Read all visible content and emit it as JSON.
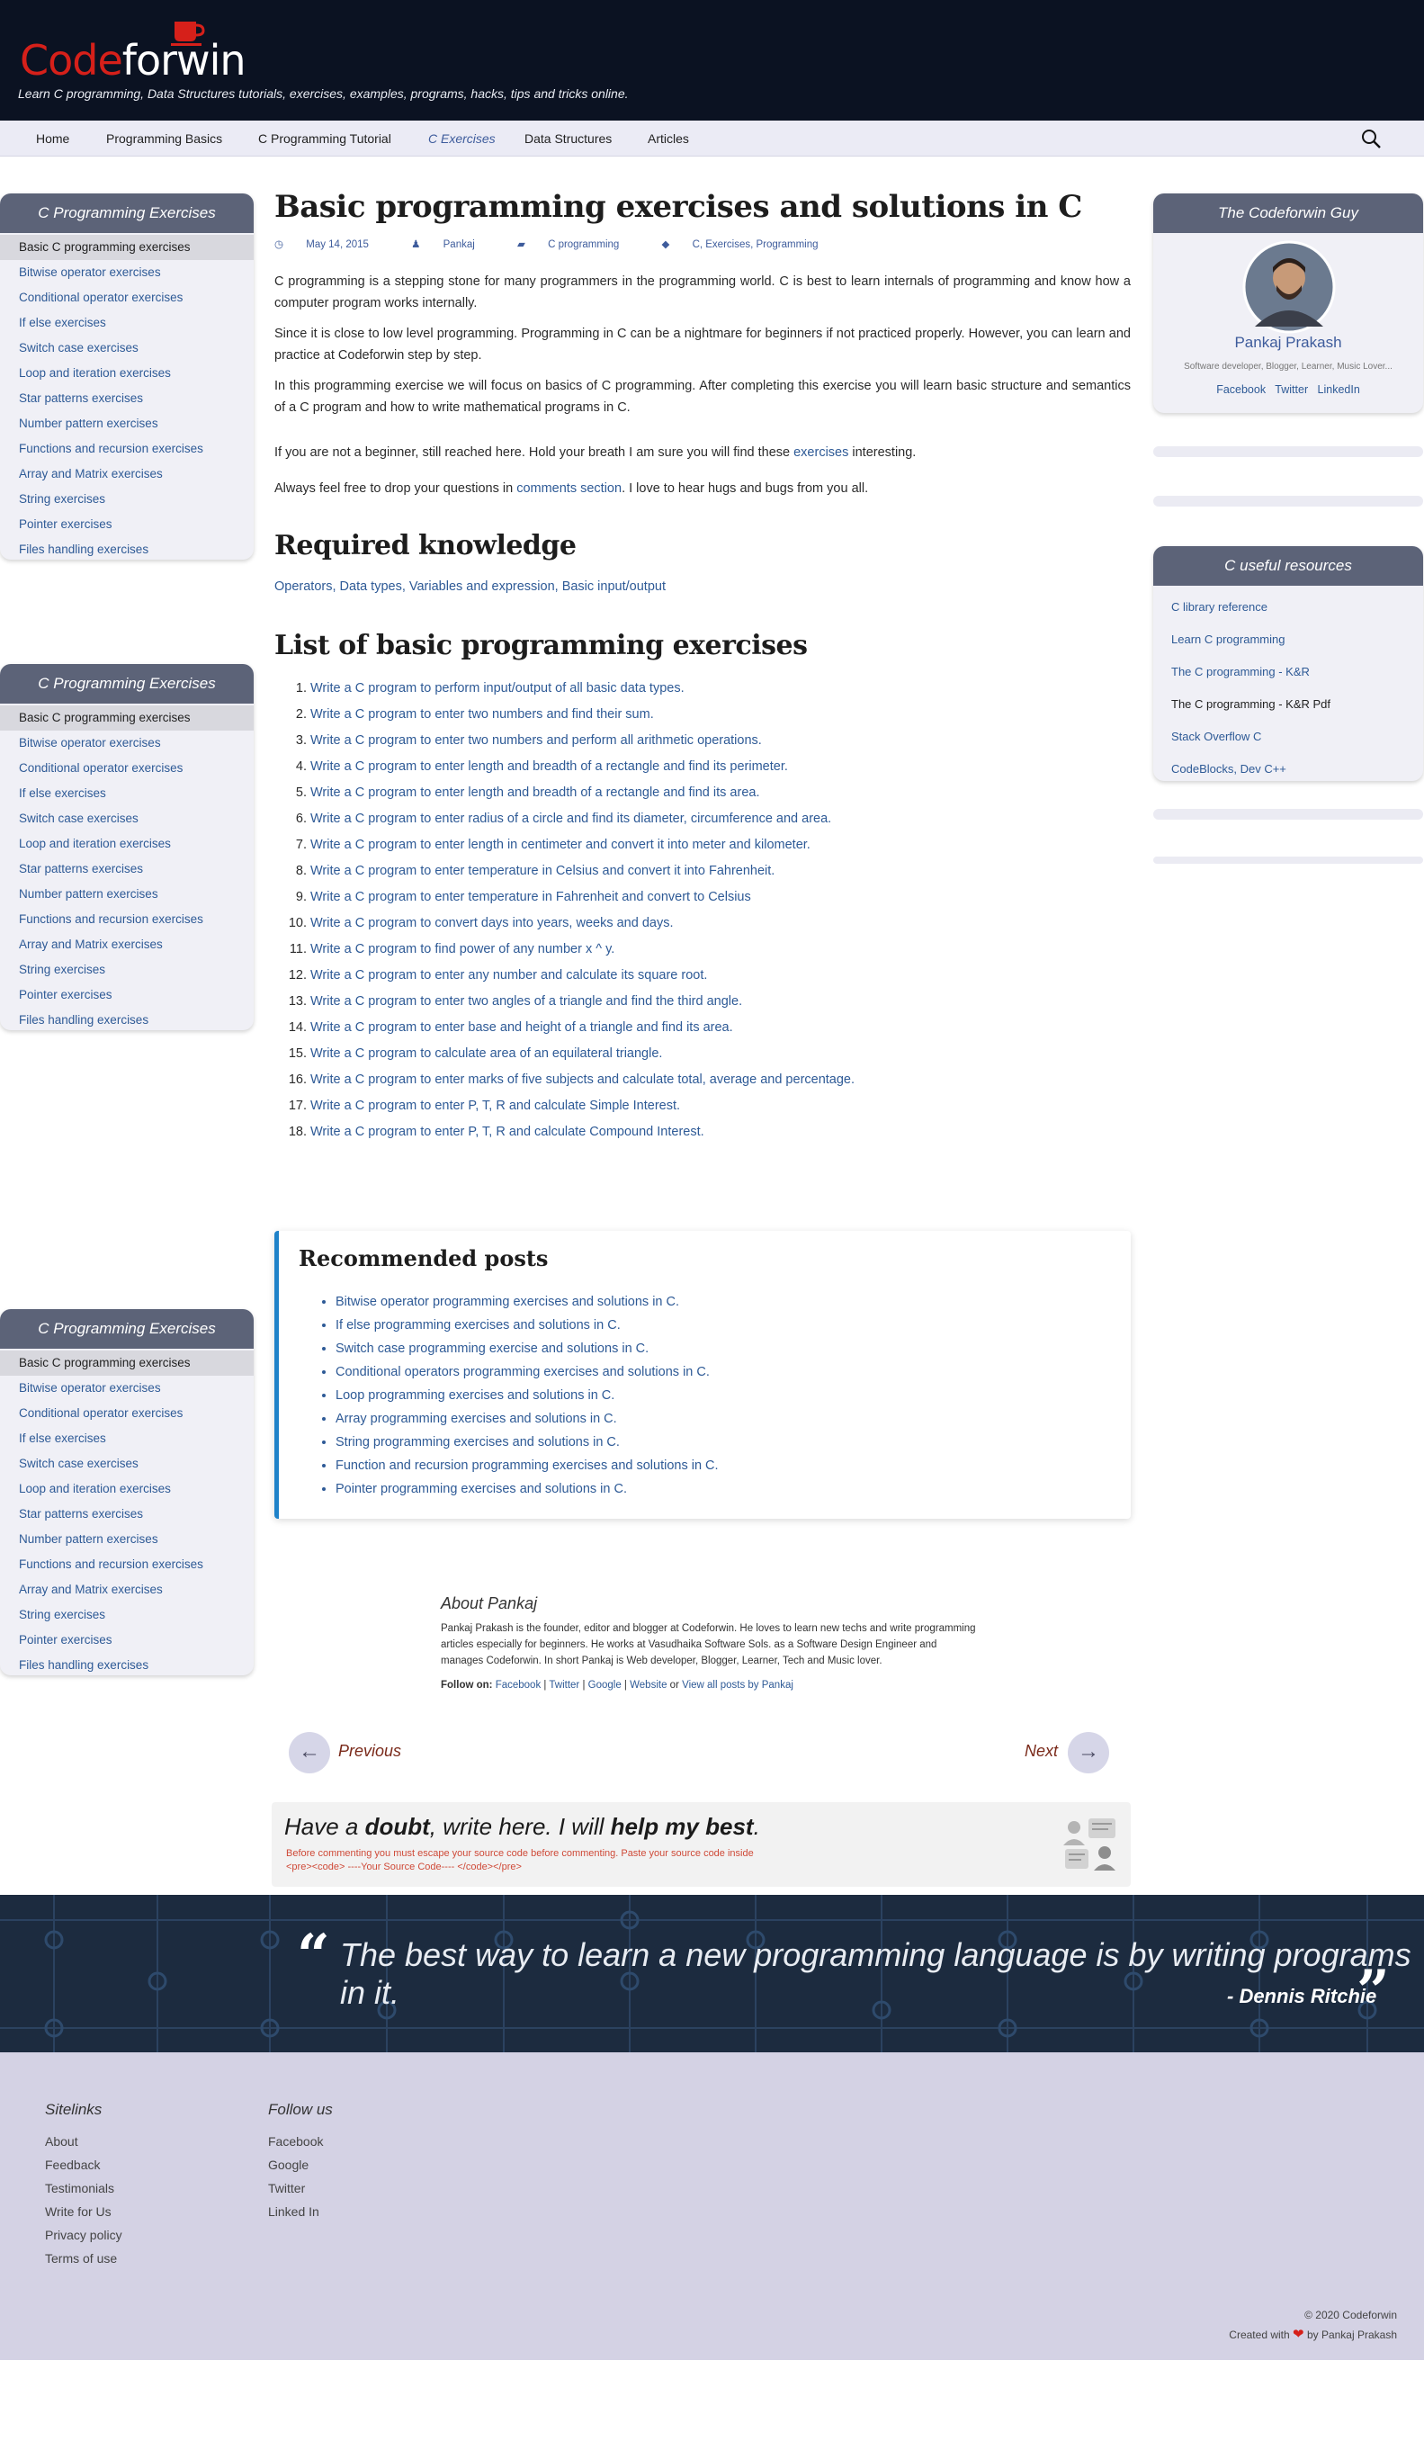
{
  "header": {
    "logo_code": "Code",
    "logo_forwin": "forwin",
    "tagline": "Learn C programming, Data Structures tutorials, exercises, examples, programs, hacks, tips and tricks online."
  },
  "nav": {
    "items": [
      "Home",
      "Programming Basics",
      "C Programming Tutorial",
      "C Exercises",
      "Data Structures",
      "Articles"
    ]
  },
  "left_sidebar": {
    "title": "C Programming Exercises",
    "items": [
      "Basic C programming exercises",
      "Bitwise operator exercises",
      "Conditional operator exercises",
      "If else exercises",
      "Switch case exercises",
      "Loop and iteration exercises",
      "Star patterns exercises",
      "Number pattern exercises",
      "Functions and recursion exercises",
      "Array and Matrix exercises",
      "String exercises",
      "Pointer exercises",
      "Files handling exercises"
    ]
  },
  "author_widget": {
    "title": "The Codeforwin Guy",
    "name": "Pankaj Prakash",
    "bio": "Software developer, Blogger, Learner, Music Lover...",
    "links": [
      "Facebook",
      "Twitter",
      "LinkedIn"
    ]
  },
  "resources_widget": {
    "title": "C useful resources",
    "items": [
      "C library reference",
      "Learn C programming",
      "The C programming - K&R",
      "The C programming - K&R Pdf",
      "Stack Overflow C",
      "CodeBlocks, Dev C++"
    ]
  },
  "article": {
    "title": "Basic programming exercises and solutions in C",
    "meta": {
      "date": "May 14, 2015",
      "author": "Pankaj",
      "category": "C programming",
      "tags": "C, Exercises, Programming"
    },
    "paragraphs": [
      "C programming is a stepping stone for many programmers in the programming world. C is best to learn internals of programming and know how a computer program works internally.",
      "Since it is close to low level programming. Programming in C can be a nightmare for beginners if not practiced properly. However, you can learn and practice at Codeforwin step by step.",
      "In this programming exercise we will focus on basics of C programming. After completing this exercise you will learn basic structure and semantics of a C program and how to write mathematical programs in C."
    ],
    "beginner_pre": "If you are not a beginner, still reached here. Hold your breath I am sure you will find these ",
    "beginner_link": "exercises",
    "beginner_post": " interesting.",
    "comments_pre": "Always feel free to drop your questions in ",
    "comments_link": "comments section",
    "comments_post": ". I love to hear hugs and bugs from you all.",
    "knowledge_heading": "Required knowledge",
    "knowledge_links": "Operators, Data types, Variables and expression, Basic input/output",
    "list_heading": "List of basic programming exercises",
    "exercises": [
      "Write a C program to perform input/output of all basic data types.",
      "Write a C program to enter two numbers and find their sum.",
      "Write a C program to enter two numbers and perform all arithmetic operations.",
      "Write a C program to enter length and breadth of a rectangle and find its perimeter.",
      "Write a C program to enter length and breadth of a rectangle and find its area.",
      "Write a C program to enter radius of a circle and find its diameter, circumference and area.",
      "Write a C program to enter length in centimeter and convert it into meter and kilometer.",
      "Write a C program to enter temperature in Celsius and convert it into Fahrenheit.",
      "Write a C program to enter temperature in Fahrenheit and convert to Celsius",
      "Write a C program to convert days into years, weeks and days.",
      "Write a C program to find power of any number x ^ y.",
      "Write a C program to enter any number and calculate its square root.",
      "Write a C program to enter two angles of a triangle and find the third angle.",
      "Write a C program to enter base and height of a triangle and find its area.",
      "Write a C program to calculate area of an equilateral triangle.",
      "Write a C program to enter marks of five subjects and calculate total, average and percentage.",
      "Write a C program to enter P, T, R and calculate Simple Interest.",
      "Write a C program to enter P, T, R and calculate Compound Interest."
    ]
  },
  "recommended": {
    "title": "Recommended posts",
    "items": [
      "Bitwise operator programming exercises and solutions in C.",
      "If else programming exercises and solutions in C.",
      "Switch case programming exercise and solutions in C.",
      "Conditional operators programming exercises and solutions in C.",
      "Loop programming exercises and solutions in C.",
      "Array programming exercises and solutions in C.",
      "String programming exercises and solutions in C.",
      "Function and recursion programming exercises and solutions in C.",
      "Pointer programming exercises and solutions in C."
    ]
  },
  "about": {
    "title": "About Pankaj",
    "text": "Pankaj Prakash is the founder, editor and blogger at Codeforwin. He loves to learn new techs and write programming articles especially for beginners. He works at Vasudhaika Software Sols. as a Software Design Engineer and manages Codeforwin. In short Pankaj is Web developer, Blogger, Learner, Tech and Music lover.",
    "follow_label": "Follow on:",
    "follow_links": [
      "Facebook",
      "Twitter",
      "Google",
      "Website"
    ],
    "or": "or",
    "view_all": "View all posts by Pankaj"
  },
  "post_nav": {
    "prev_arrow": "←",
    "prev_label": "Previous",
    "next_label": "Next",
    "next_arrow": "→"
  },
  "comment_box": {
    "head_1": "Have a ",
    "head_bold_1": "doubt",
    "head_2": ", write here. I will ",
    "head_bold_2": "help my best",
    "head_3": ".",
    "note_1": "Before commenting you must escape your source code before commenting. Paste your source code inside",
    "note_2": "<pre><code> ----Your Source Code---- </code></pre>"
  },
  "quote": {
    "open": "“",
    "text": "The best way to learn a new programming language is by writing programs in it.",
    "close": "”",
    "author": "- Dennis Ritchie"
  },
  "footer": {
    "sitelinks_title": "Sitelinks",
    "sitelinks": [
      "About",
      "Feedback",
      "Testimonials",
      "Write for Us",
      "Privacy policy",
      "Terms of use"
    ],
    "follow_title": "Follow us",
    "follow": [
      "Facebook",
      "Google",
      "Twitter",
      "Linked In"
    ],
    "copyright": "© 2020 Codeforwin",
    "created_pre": "Created with",
    "created_post": "by Pankaj Prakash"
  },
  "colors": {
    "header_bg": "#0b1222",
    "brand_red": "#d6201a",
    "link": "#2e5a96",
    "widget_title_bg": "#5c6378",
    "quote_bg": "#1c2b3f",
    "footer_bg": "#d4d2e4"
  }
}
